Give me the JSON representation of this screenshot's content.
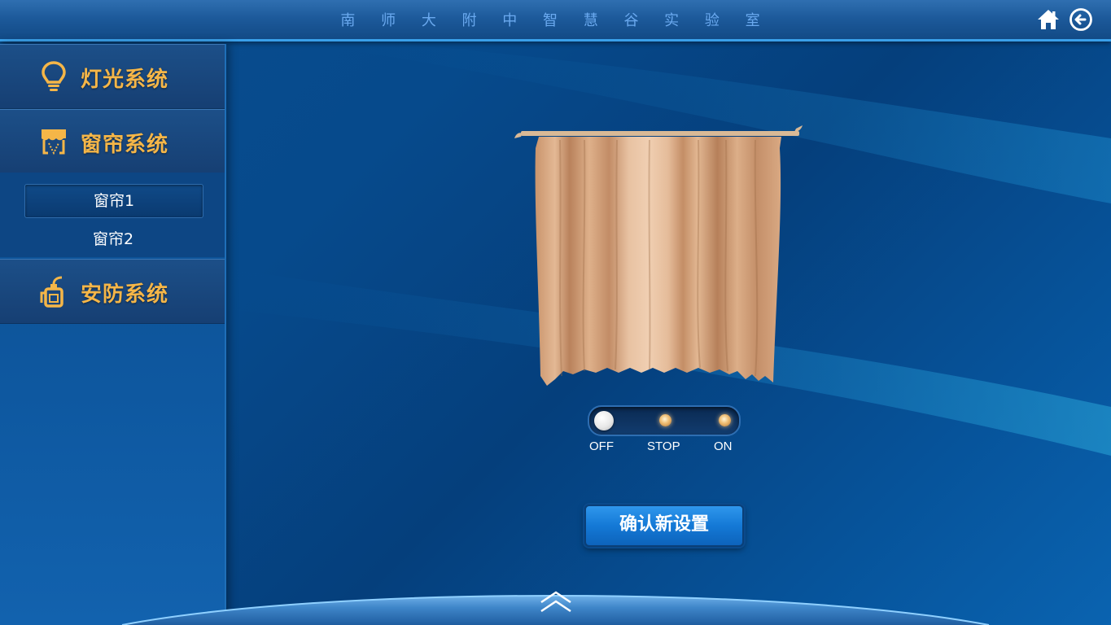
{
  "header": {
    "title": "南 师 大 附 中 智 慧 谷 实 验 室",
    "home_icon": "home-icon",
    "back_icon": "back-arrow-icon"
  },
  "sidebar": {
    "items": [
      {
        "label": "灯光系统",
        "icon": "lightbulb-icon"
      },
      {
        "label": "窗帘系统",
        "icon": "curtain-icon"
      },
      {
        "label": "安防系统",
        "icon": "fire-extinguisher-icon"
      }
    ],
    "subitems": [
      {
        "label": "窗帘1",
        "active": true
      },
      {
        "label": "窗帘2",
        "active": false
      }
    ]
  },
  "curtain_control": {
    "switch_options": [
      "OFF",
      "STOP",
      "ON"
    ],
    "selected": "OFF",
    "confirm_label": "确认新设置"
  },
  "footer": {
    "expand_icon": "chevron-up-double-icon"
  },
  "colors": {
    "accent": "#3aa0ea",
    "menu_label": "#f5b648",
    "title": "#6aa9ef",
    "button": "#1479d6"
  }
}
